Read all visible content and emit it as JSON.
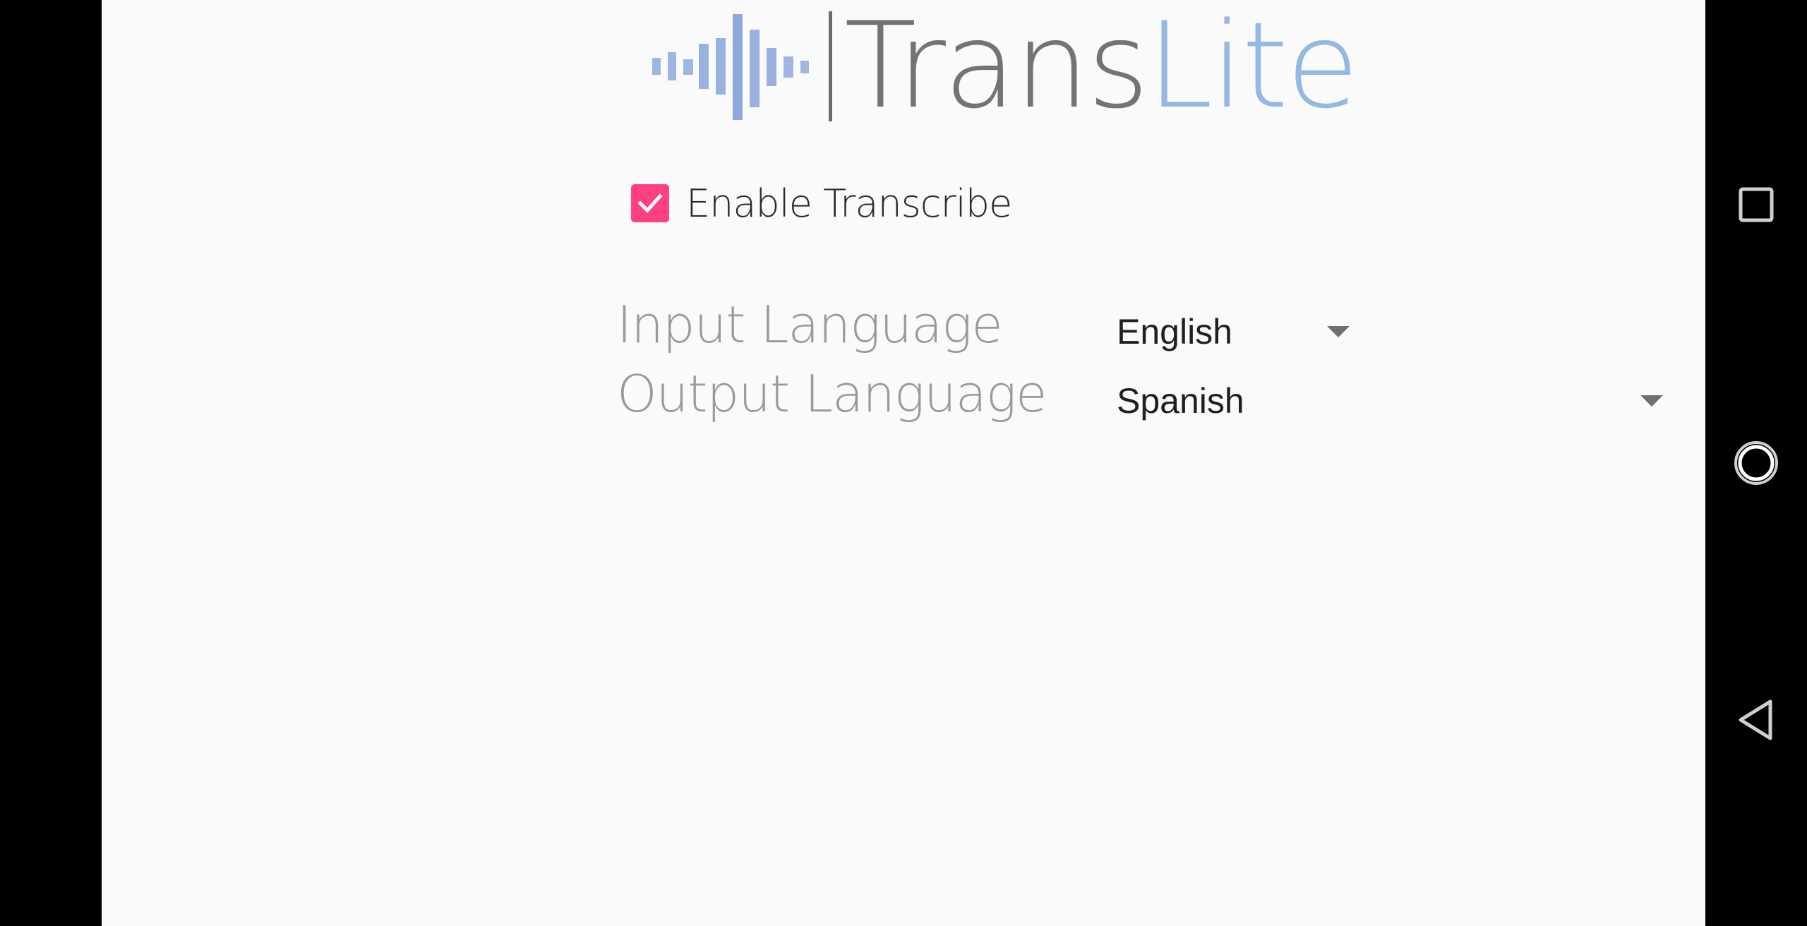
{
  "logo": {
    "text_trans": "Trans",
    "text_lite": "Lite",
    "colors": {
      "trans": "#767272",
      "lite": "#93b8e2",
      "wave": "#8fa9dc"
    }
  },
  "transcribe": {
    "label": "Enable Transcribe",
    "checked": true,
    "color": "#ff4081"
  },
  "input_language": {
    "label": "Input Language",
    "value": "English"
  },
  "output_language": {
    "label": "Output Language",
    "value": "Spanish"
  },
  "navbar": {
    "icons": [
      "recent-apps-icon",
      "home-icon",
      "back-icon"
    ]
  }
}
